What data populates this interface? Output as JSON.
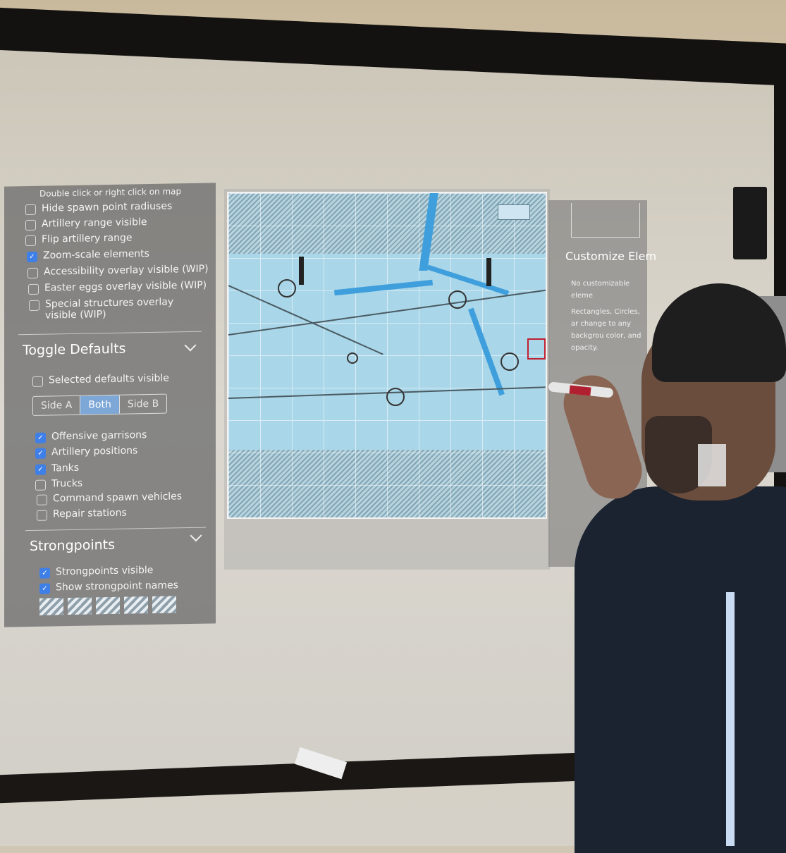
{
  "left_panel": {
    "hint": "Double click or right click on map",
    "options": [
      {
        "label": "Hide spawn point radiuses",
        "checked": false
      },
      {
        "label": "Artillery range visible",
        "checked": false
      },
      {
        "label": "Flip artillery range",
        "checked": false
      },
      {
        "label": "Zoom-scale elements",
        "checked": true
      },
      {
        "label": "Accessibility overlay visible (WIP)",
        "checked": false
      },
      {
        "label": "Easter eggs overlay visible (WIP)",
        "checked": false
      },
      {
        "label": "Special structures overlay visible (WIP)",
        "checked": false
      }
    ],
    "toggle_defaults": {
      "title": "Toggle Defaults",
      "selected_visible": {
        "label": "Selected defaults visible",
        "checked": false
      },
      "segments": [
        "Side A",
        "Both",
        "Side B"
      ],
      "active_segment": "Both",
      "items": [
        {
          "label": "Offensive garrisons",
          "checked": true
        },
        {
          "label": "Artillery positions",
          "checked": true
        },
        {
          "label": "Tanks",
          "checked": true
        },
        {
          "label": "Trucks",
          "checked": false
        },
        {
          "label": "Command spawn vehicles",
          "checked": false
        },
        {
          "label": "Repair stations",
          "checked": false
        }
      ]
    },
    "strongpoints": {
      "title": "Strongpoints",
      "items": [
        {
          "label": "Strongpoints visible",
          "checked": true
        },
        {
          "label": "Show strongpoint names",
          "checked": true
        }
      ]
    }
  },
  "right_panel": {
    "title": "Customize Elem",
    "no_elements": "No customizable eleme",
    "description": "Rectangles, Circles, ar change to any backgrou color, and opacity."
  },
  "colors": {
    "checkbox_on": "#3f7fe8",
    "segment_active": "#7da7d6",
    "water": "#3f9fdc",
    "marker_red": "#c02030"
  }
}
